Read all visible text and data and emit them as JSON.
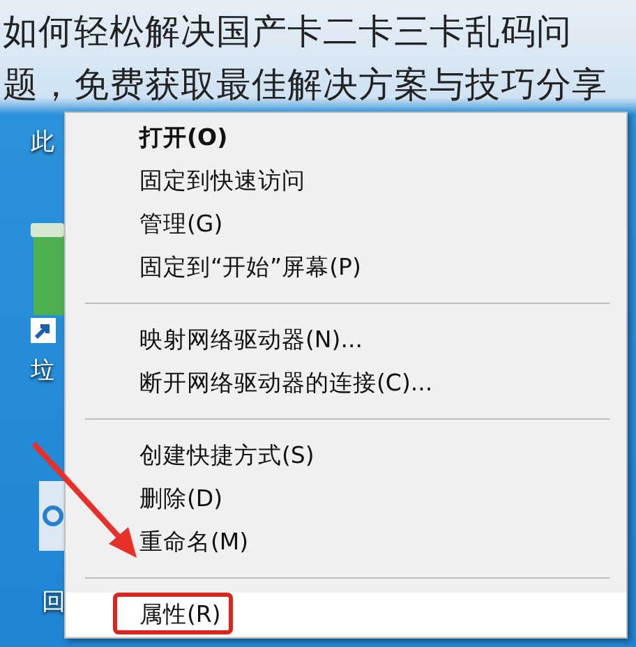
{
  "title_overlay": "如何轻松解决国产卡二卡三卡乱码问题，免费获取最佳解决方案与技巧分享",
  "desktop_icons": [
    {
      "kind": "pc",
      "label": "此"
    },
    {
      "kind": "bin",
      "label": "垃"
    },
    {
      "kind": "recycle",
      "label": "回"
    }
  ],
  "context_menu": {
    "items": [
      {
        "kind": "item",
        "label": "打开(O)",
        "default": true,
        "highlighted": false,
        "annotated": false
      },
      {
        "kind": "item",
        "label": "固定到快速访问",
        "default": false,
        "highlighted": false,
        "annotated": false
      },
      {
        "kind": "item",
        "label": "管理(G)",
        "default": false,
        "highlighted": false,
        "annotated": false
      },
      {
        "kind": "item",
        "label": "固定到“开始”屏幕(P)",
        "default": false,
        "highlighted": false,
        "annotated": false
      },
      {
        "kind": "separator"
      },
      {
        "kind": "item",
        "label": "映射网络驱动器(N)...",
        "default": false,
        "highlighted": false,
        "annotated": false
      },
      {
        "kind": "item",
        "label": "断开网络驱动器的连接(C)...",
        "default": false,
        "highlighted": false,
        "annotated": false
      },
      {
        "kind": "separator"
      },
      {
        "kind": "item",
        "label": "创建快捷方式(S)",
        "default": false,
        "highlighted": false,
        "annotated": false
      },
      {
        "kind": "item",
        "label": "删除(D)",
        "default": false,
        "highlighted": false,
        "annotated": false
      },
      {
        "kind": "item",
        "label": "重命名(M)",
        "default": false,
        "highlighted": false,
        "annotated": false
      },
      {
        "kind": "separator"
      },
      {
        "kind": "item",
        "label": "属性(R)",
        "default": false,
        "highlighted": true,
        "annotated": true
      }
    ]
  }
}
